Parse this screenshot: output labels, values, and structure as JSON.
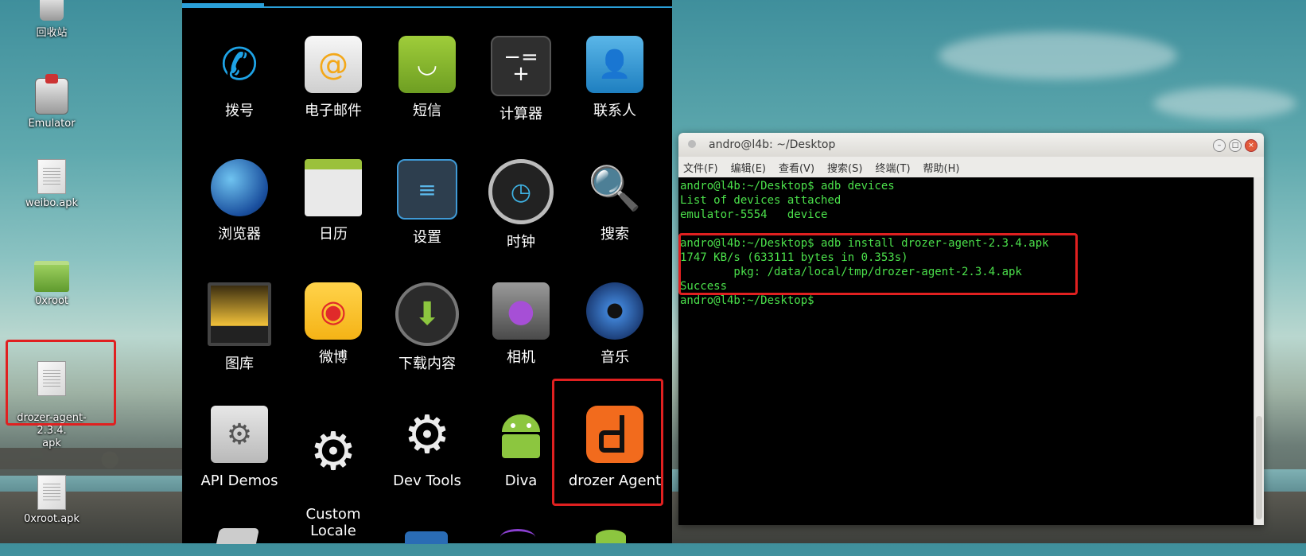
{
  "desktop": {
    "icons": [
      {
        "label": "回收站",
        "icon": "trash-icon"
      },
      {
        "label": "Emulator",
        "icon": "emulator-icon"
      },
      {
        "label": "weibo.apk",
        "icon": "document-icon"
      },
      {
        "label": "0xroot",
        "icon": "folder-icon"
      },
      {
        "label": "drozer-agent-2.3.4.\napk",
        "icon": "document-icon"
      },
      {
        "label": "0xroot.apk",
        "icon": "document-locked-icon"
      }
    ]
  },
  "android": {
    "apps": [
      {
        "label": "拨号",
        "icon": "phone-icon"
      },
      {
        "label": "电子邮件",
        "icon": "email-icon"
      },
      {
        "label": "短信",
        "icon": "sms-icon"
      },
      {
        "label": "计算器",
        "icon": "calculator-icon"
      },
      {
        "label": "联系人",
        "icon": "contacts-icon"
      },
      {
        "label": "浏览器",
        "icon": "globe-icon"
      },
      {
        "label": "日历",
        "icon": "calendar-icon"
      },
      {
        "label": "设置",
        "icon": "settings-sliders-icon"
      },
      {
        "label": "时钟",
        "icon": "clock-icon"
      },
      {
        "label": "搜索",
        "icon": "magnifier-icon"
      },
      {
        "label": "图库",
        "icon": "gallery-icon"
      },
      {
        "label": "微博",
        "icon": "weibo-icon"
      },
      {
        "label": "下载内容",
        "icon": "download-icon"
      },
      {
        "label": "相机",
        "icon": "camera-icon"
      },
      {
        "label": "音乐",
        "icon": "music-speaker-icon"
      },
      {
        "label": "API Demos",
        "icon": "gear-folder-icon"
      },
      {
        "label": "Custom\nLocale",
        "icon": "gear-icon"
      },
      {
        "label": "Dev Tools",
        "icon": "gear-icon"
      },
      {
        "label": "Diva",
        "icon": "android-icon"
      },
      {
        "label": "drozer Agent",
        "icon": "drozer-icon"
      }
    ]
  },
  "terminal": {
    "title": "andro@l4b: ~/Desktop",
    "menu": [
      "文件(F)",
      "编辑(E)",
      "查看(V)",
      "搜索(S)",
      "终端(T)",
      "帮助(H)"
    ],
    "lines": [
      "andro@l4b:~/Desktop$ adb devices",
      "List of devices attached",
      "emulator-5554   device",
      "",
      "andro@l4b:~/Desktop$ adb install drozer-agent-2.3.4.apk",
      "1747 KB/s (633111 bytes in 0.353s)",
      "        pkg: /data/local/tmp/drozer-agent-2.3.4.apk",
      "Success",
      "andro@l4b:~/Desktop$ "
    ]
  },
  "colors": {
    "highlight": "#e02020",
    "terminal_text": "#4be04b",
    "android_accent": "#2a9fd8",
    "drozer_orange": "#f26b1d"
  }
}
